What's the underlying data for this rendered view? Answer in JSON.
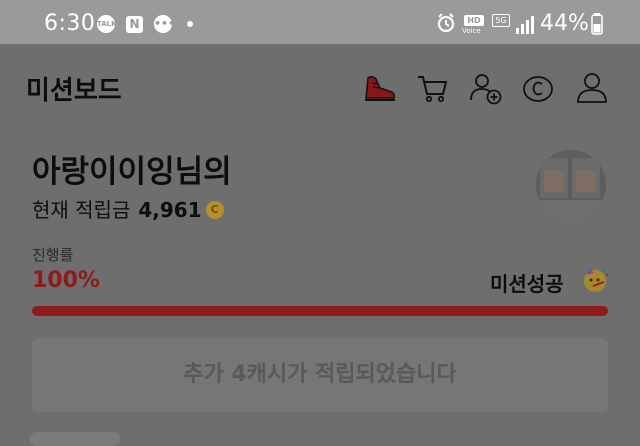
{
  "status_bar": {
    "time": "6:30",
    "notif_talk": "TALK",
    "notif_n": "N",
    "hd_badge": "HD",
    "voice_label": "Voice",
    "network": "5G",
    "battery": "44%"
  },
  "header": {
    "title": "미션보드",
    "icons": [
      "sneaker-icon",
      "cart-icon",
      "add-user-icon",
      "cash-c-icon",
      "profile-icon"
    ]
  },
  "profile": {
    "greeting": "아랑이이잉님의",
    "points_label": "현재 적립금",
    "points_value": "4,961",
    "coin_symbol": "C"
  },
  "progress": {
    "label": "진행률",
    "percent_text": "100%",
    "percent": 100,
    "status_text": "미션성공",
    "bar_color": "#8f1c1c"
  },
  "bonus_button": {
    "label": "추가 4캐시가 적립되었습니다"
  }
}
